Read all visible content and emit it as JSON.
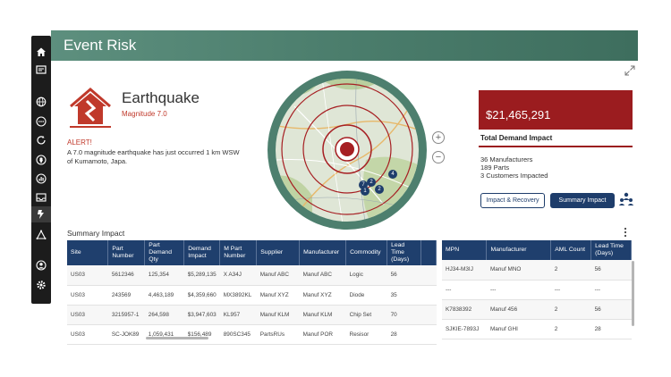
{
  "header": {
    "title": "Event Risk"
  },
  "rail": {
    "items": [
      {
        "icon": "home-icon"
      },
      {
        "icon": "dashboard-icon"
      },
      {
        "icon": "globe-icon"
      },
      {
        "icon": "more-icon"
      },
      {
        "icon": "refresh-icon"
      },
      {
        "icon": "location-icon"
      },
      {
        "icon": "analytics-icon"
      },
      {
        "icon": "inbox-icon"
      },
      {
        "icon": "event-risk-icon"
      },
      {
        "icon": "network-icon"
      },
      {
        "icon": "user-icon"
      },
      {
        "icon": "settings-icon"
      }
    ]
  },
  "event": {
    "title": "Earthquake",
    "magnitude": "Magnitude 7.0",
    "alert_title": "ALERT!",
    "alert_text": "A 7.0 magnitude earthquake has just occurred 1 km WSW of Kumamoto, Japa."
  },
  "map": {
    "markers": [
      {
        "label": "7"
      },
      {
        "label": "2"
      },
      {
        "label": "4"
      },
      {
        "label": "1"
      },
      {
        "label": "2"
      }
    ]
  },
  "demand": {
    "value": "$21,465,291",
    "label": "Total Demand Impact",
    "stats": [
      "36 Manufacturers",
      "189 Parts",
      "3 Customers Impacted"
    ],
    "btn_impact": "Impact & Recovery",
    "btn_summary": "Summary Impact",
    "accent": "#9b1c1f",
    "navy": "#1f3f6d"
  },
  "summary": {
    "title": "Summary Impact",
    "table1": {
      "headers": [
        "Site",
        "Part Number",
        "Part Demand Qty",
        "Demand Impact",
        "M Part Number",
        "Supplier",
        "Manufacturer",
        "Commodity",
        "Lead Time (Days)",
        ""
      ],
      "rows": [
        [
          "US03",
          "5612346",
          "125,354",
          "$5,289,135",
          "X A34J",
          "Manuf ABC",
          "Manuf ABC",
          "Logic",
          "56",
          ""
        ],
        [
          "US03",
          "243569",
          "4,463,189",
          "$4,359,660",
          "MX3892KL",
          "Manuf XYZ",
          "Manuf XYZ",
          "Diode",
          "35",
          ""
        ],
        [
          "US03",
          "3215957-1",
          "264,598",
          "$3,947,603",
          "KL957",
          "Manuf KLM",
          "Manuf KLM",
          "Chip Set",
          "70",
          ""
        ],
        [
          "US03",
          "SC-JOK89",
          "1,059,431",
          "$156,489",
          "890SC345",
          "PartsRUs",
          "Manuf POR",
          "Resisor",
          "28",
          ""
        ]
      ]
    },
    "table2": {
      "headers": [
        "MPN",
        "Manufacturer",
        "AML Count",
        "Lead Time (Days)"
      ],
      "rows": [
        [
          "HJ34-M3IJ",
          "Manuf MNO",
          "2",
          "56"
        ],
        [
          "---",
          "---",
          "---",
          "---"
        ],
        [
          "K7838392",
          "Manuf 456",
          "2",
          "56"
        ],
        [
          "SJKIE-7893J",
          "Manuf GHI",
          "2",
          "28"
        ]
      ]
    }
  }
}
